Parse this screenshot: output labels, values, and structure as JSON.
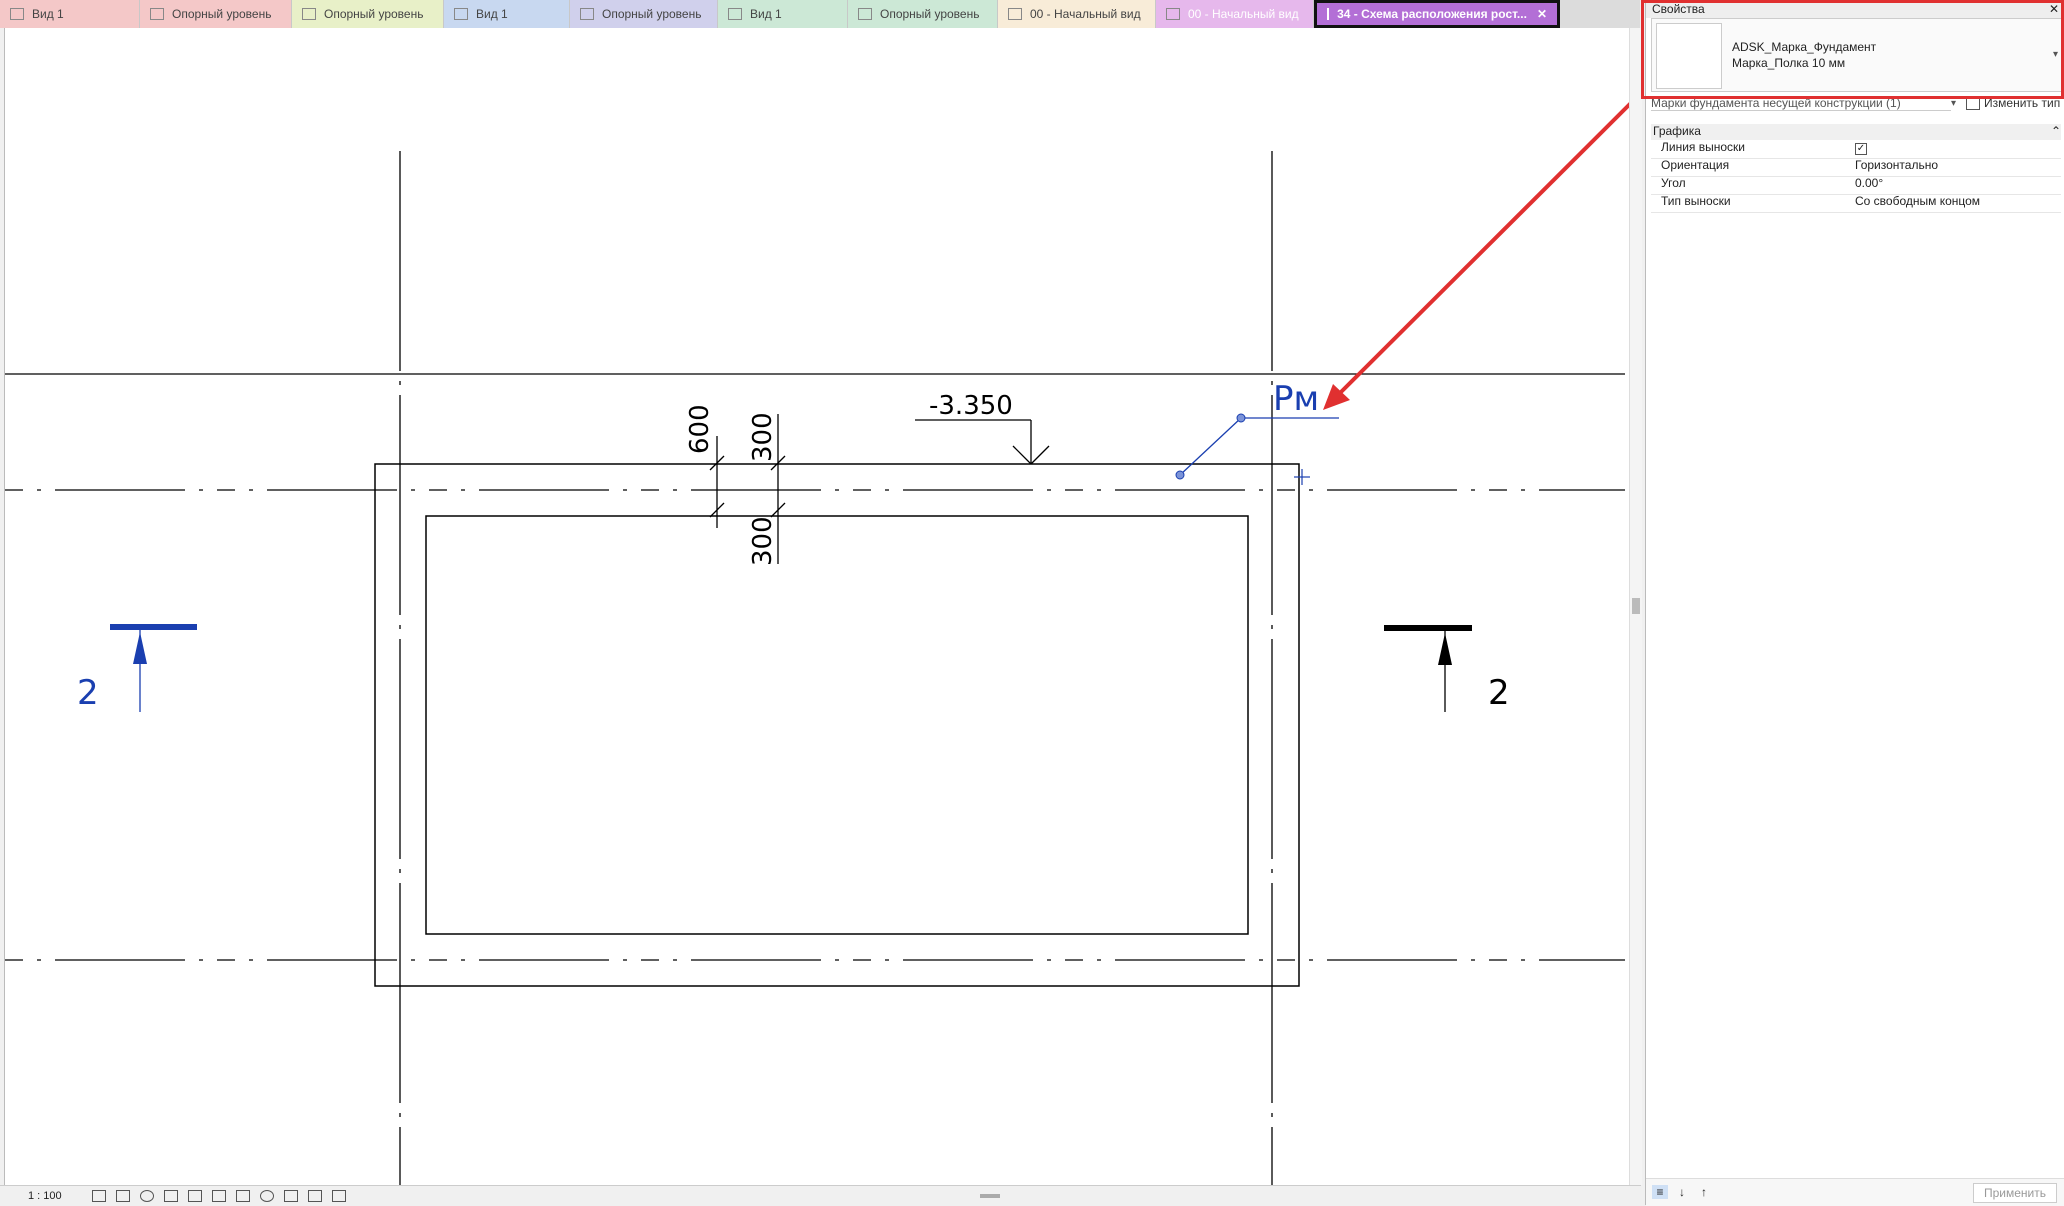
{
  "tabs": [
    {
      "label": "Вид 1",
      "color": "#f4c8c8"
    },
    {
      "label": "Опорный уровень",
      "color": "#f4c8c8"
    },
    {
      "label": "Опорный уровень",
      "color": "#e8f0c8"
    },
    {
      "label": "Вид 1",
      "color": "#c8d8f0"
    },
    {
      "label": "Опорный уровень",
      "color": "#d0d0ec"
    },
    {
      "label": "Вид 1",
      "color": "#cce8d6"
    },
    {
      "label": "Опорный уровень",
      "color": "#cce8d6"
    },
    {
      "label": "00 - Начальный вид",
      "color": "#f8ecd8"
    },
    {
      "label": "00 - Начальный вид",
      "color": "#e6b8ec"
    },
    {
      "label": "34 - Схема расположения рост...",
      "color": "#b36fd6"
    }
  ],
  "active_tab_close": "✕",
  "drawing": {
    "elevation_label": "-3.350",
    "dim_600": "600",
    "dim_300_top": "300",
    "dim_300_bottom": "300",
    "tag_label": "Рм",
    "section_left": "2",
    "section_right": "2"
  },
  "statusbar": {
    "scale": "1 : 100"
  },
  "properties": {
    "title": "Свойства",
    "close_icon": "✕",
    "type_family": "ADSK_Марка_Фундамент",
    "type_name": "Марка_Полка 10 мм",
    "filter": "Марки фундамента несущей конструкции (1)",
    "edit_type": "Изменить тип",
    "group": "Графика",
    "rows": [
      {
        "key": "Линия выноски",
        "value": ""
      },
      {
        "key": "Ориентация",
        "value": "Горизонтально"
      },
      {
        "key": "Угол",
        "value": "0.00°"
      },
      {
        "key": "Тип выноски",
        "value": "Со свободным концом"
      }
    ],
    "apply": "Применить"
  },
  "colors": {
    "accent": "#b36fd6",
    "highlight": "#e03030",
    "tag_blue": "#1a3fb0"
  }
}
